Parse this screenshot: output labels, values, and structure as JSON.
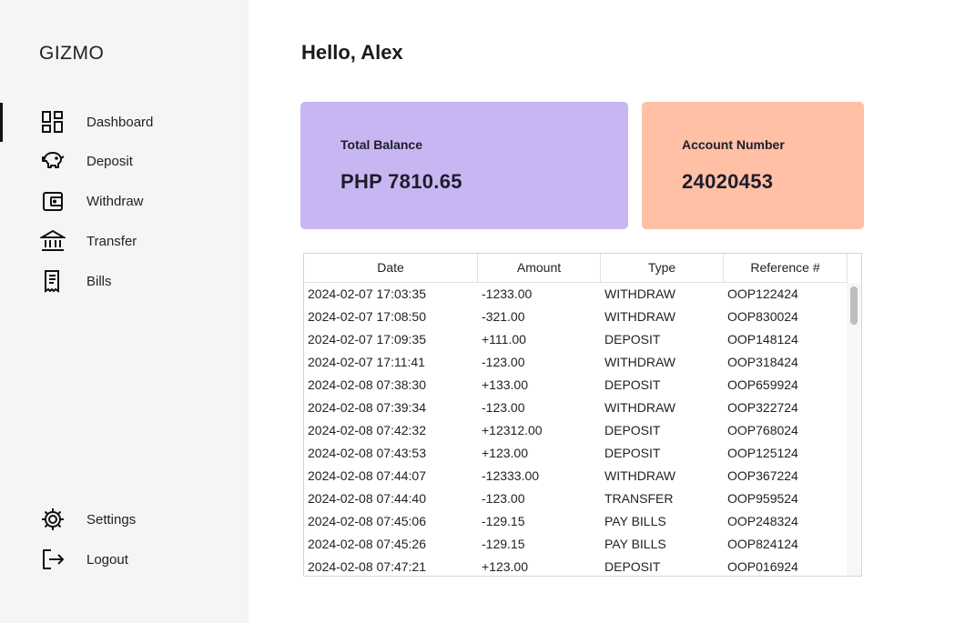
{
  "app": {
    "brand": "GIZMO"
  },
  "sidebar": {
    "nav": [
      {
        "label": "Dashboard",
        "icon": "dashboard-icon"
      },
      {
        "label": "Deposit",
        "icon": "piggy-bank-icon"
      },
      {
        "label": "Withdraw",
        "icon": "wallet-icon"
      },
      {
        "label": "Transfer",
        "icon": "bank-icon"
      },
      {
        "label": "Bills",
        "icon": "receipt-icon"
      }
    ],
    "bottom": [
      {
        "label": "Settings",
        "icon": "gear-icon"
      },
      {
        "label": "Logout",
        "icon": "logout-icon"
      }
    ],
    "active": "Dashboard"
  },
  "main": {
    "greeting": "Hello, Alex",
    "cards": {
      "balance": {
        "label": "Total Balance",
        "value": "PHP 7810.65",
        "color": "#c8b6f2"
      },
      "account": {
        "label": "Account Number",
        "value": "24020453",
        "color": "#ffc0a6"
      }
    },
    "table": {
      "columns": [
        "Date",
        "Amount",
        "Type",
        "Reference #"
      ],
      "rows": [
        [
          "2024-02-07 17:03:35",
          "-1233.00",
          "WITHDRAW",
          "OOP122424"
        ],
        [
          "2024-02-07 17:08:50",
          "-321.00",
          "WITHDRAW",
          "OOP830024"
        ],
        [
          "2024-02-07 17:09:35",
          "+111.00",
          "DEPOSIT",
          "OOP148124"
        ],
        [
          "2024-02-07 17:11:41",
          "-123.00",
          "WITHDRAW",
          "OOP318424"
        ],
        [
          "2024-02-08 07:38:30",
          "+133.00",
          "DEPOSIT",
          "OOP659924"
        ],
        [
          "2024-02-08 07:39:34",
          "-123.00",
          "WITHDRAW",
          "OOP322724"
        ],
        [
          "2024-02-08 07:42:32",
          "+12312.00",
          "DEPOSIT",
          "OOP768024"
        ],
        [
          "2024-02-08 07:43:53",
          "+123.00",
          "DEPOSIT",
          "OOP125124"
        ],
        [
          "2024-02-08 07:44:07",
          "-12333.00",
          "WITHDRAW",
          "OOP367224"
        ],
        [
          "2024-02-08 07:44:40",
          "-123.00",
          "TRANSFER",
          "OOP959524"
        ],
        [
          "2024-02-08 07:45:06",
          "-129.15",
          "PAY BILLS",
          "OOP248324"
        ],
        [
          "2024-02-08 07:45:26",
          "-129.15",
          "PAY BILLS",
          "OOP824124"
        ],
        [
          "2024-02-08 07:47:21",
          "+123.00",
          "DEPOSIT",
          "OOP016924"
        ]
      ]
    }
  }
}
